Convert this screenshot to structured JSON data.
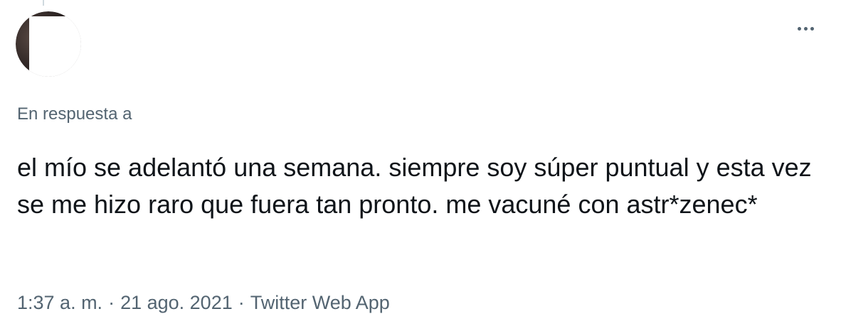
{
  "tweet": {
    "reply_context": "En respuesta a",
    "text": "el mío se adelantó una semana. siempre soy súper puntual y esta vez se me hizo raro que fuera tan pronto. me vacuné con astr*zenec*",
    "time": "1:37 a. m.",
    "date": "21 ago. 2021",
    "separator": "·",
    "source": "Twitter Web App",
    "more_icon": "more-horizontal-icon"
  },
  "colors": {
    "text_primary": "#0f1419",
    "text_secondary": "#536471",
    "background": "#ffffff"
  }
}
